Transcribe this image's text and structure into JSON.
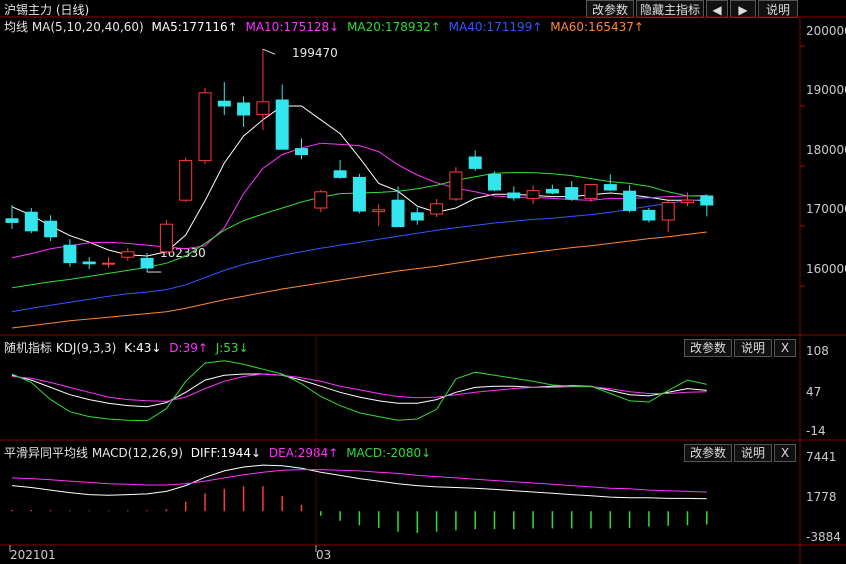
{
  "header": {
    "title": "沪锡主力 (日线)",
    "buttons": [
      "改参数",
      "隐藏主指标",
      "◀",
      "▶",
      "说明"
    ]
  },
  "main_panel": {
    "legend": [
      {
        "text": "均线 MA(5,10,20,40,60)",
        "color": "#e6e6e6"
      },
      {
        "text": "MA5:177116↑",
        "color": "#ffffff"
      },
      {
        "text": "MA10:175128↓",
        "color": "#ff33ff"
      },
      {
        "text": "MA20:178932↑",
        "color": "#33dd33"
      },
      {
        "text": "MA40:171199↑",
        "color": "#3355ff"
      },
      {
        "text": "MA60:165437↑",
        "color": "#ff8833"
      }
    ],
    "y_ticks": [
      "200000",
      "190000",
      "180000",
      "170000",
      "160000"
    ],
    "annotations": {
      "high": "199470",
      "low": "162330"
    }
  },
  "kdj_panel": {
    "legend": [
      {
        "text": "随机指标 KDJ(9,3,3)",
        "color": "#e6e6e6"
      },
      {
        "text": "K:43↓",
        "color": "#ffffff"
      },
      {
        "text": "D:39↑",
        "color": "#ff33ff"
      },
      {
        "text": "J:53↓",
        "color": "#33dd33"
      }
    ],
    "buttons": [
      "改参数",
      "说明",
      "X"
    ],
    "y_ticks": [
      "108",
      "47",
      "-14"
    ]
  },
  "macd_panel": {
    "legend": [
      {
        "text": "平滑异同平均线 MACD(12,26,9)",
        "color": "#e6e6e6"
      },
      {
        "text": "DIFF:1944↓",
        "color": "#ffffff"
      },
      {
        "text": "DEA:2984↑",
        "color": "#ff33ff"
      },
      {
        "text": "MACD:-2080↓",
        "color": "#33dd33"
      }
    ],
    "buttons": [
      "改参数",
      "说明",
      "X"
    ],
    "y_ticks": [
      "7441",
      "1778",
      "-3884"
    ]
  },
  "x_axis": {
    "labels": [
      "202101",
      "03"
    ]
  },
  "chart_data": [
    {
      "type": "candlestick",
      "title": "沪锡主力 (日线)",
      "ylim": [
        152000,
        202000
      ],
      "candles": [
        {
          "o": 171200,
          "h": 173500,
          "l": 169500,
          "c": 170600
        },
        {
          "o": 172300,
          "h": 173000,
          "l": 168800,
          "c": 169200
        },
        {
          "o": 170800,
          "h": 171800,
          "l": 167500,
          "c": 168200
        },
        {
          "o": 166800,
          "h": 167800,
          "l": 163200,
          "c": 163900
        },
        {
          "o": 164000,
          "h": 164800,
          "l": 162800,
          "c": 163700
        },
        {
          "o": 163800,
          "h": 164800,
          "l": 163000,
          "c": 163800
        },
        {
          "o": 164800,
          "h": 166300,
          "l": 164200,
          "c": 165700
        },
        {
          "o": 164600,
          "h": 165500,
          "l": 162330,
          "c": 163000
        },
        {
          "o": 165700,
          "h": 171000,
          "l": 165300,
          "c": 170300
        },
        {
          "o": 174300,
          "h": 181400,
          "l": 174000,
          "c": 180900
        },
        {
          "o": 180900,
          "h": 193000,
          "l": 180300,
          "c": 192200
        },
        {
          "o": 190800,
          "h": 194000,
          "l": 188500,
          "c": 190000
        },
        {
          "o": 190500,
          "h": 191600,
          "l": 186500,
          "c": 188500
        },
        {
          "o": 188600,
          "h": 199470,
          "l": 186000,
          "c": 190700
        },
        {
          "o": 191000,
          "h": 193600,
          "l": 183000,
          "c": 182800
        },
        {
          "o": 182900,
          "h": 184600,
          "l": 181100,
          "c": 181900
        },
        {
          "o": 173000,
          "h": 176000,
          "l": 172300,
          "c": 175700
        },
        {
          "o": 179200,
          "h": 181000,
          "l": 177900,
          "c": 178100
        },
        {
          "o": 178100,
          "h": 178700,
          "l": 172100,
          "c": 172500
        },
        {
          "o": 172400,
          "h": 173600,
          "l": 170000,
          "c": 172700
        },
        {
          "o": 174300,
          "h": 176600,
          "l": 169900,
          "c": 169900
        },
        {
          "o": 172200,
          "h": 173100,
          "l": 170200,
          "c": 171000
        },
        {
          "o": 172000,
          "h": 174500,
          "l": 171500,
          "c": 173700
        },
        {
          "o": 174500,
          "h": 179800,
          "l": 174200,
          "c": 179000
        },
        {
          "o": 181500,
          "h": 182600,
          "l": 179200,
          "c": 179600
        },
        {
          "o": 178600,
          "h": 179100,
          "l": 175800,
          "c": 176000
        },
        {
          "o": 175500,
          "h": 176600,
          "l": 174200,
          "c": 174700
        },
        {
          "o": 174600,
          "h": 176800,
          "l": 173700,
          "c": 175900
        },
        {
          "o": 176100,
          "h": 176900,
          "l": 175300,
          "c": 175500
        },
        {
          "o": 176400,
          "h": 177500,
          "l": 174200,
          "c": 174500
        },
        {
          "o": 174600,
          "h": 176900,
          "l": 174000,
          "c": 176900
        },
        {
          "o": 176900,
          "h": 178600,
          "l": 175800,
          "c": 176000
        },
        {
          "o": 175800,
          "h": 176800,
          "l": 172300,
          "c": 172600
        },
        {
          "o": 172600,
          "h": 173000,
          "l": 170600,
          "c": 171000
        },
        {
          "o": 171000,
          "h": 174200,
          "l": 169000,
          "c": 173900
        },
        {
          "o": 173900,
          "h": 175600,
          "l": 173300,
          "c": 174300
        },
        {
          "o": 175000,
          "h": 175300,
          "l": 171600,
          "c": 173500
        }
      ],
      "series": [
        {
          "name": "MA5",
          "color": "#ffffff",
          "values": [
            173200,
            171800,
            170000,
            168400,
            167300,
            166000,
            165200,
            165000,
            165700,
            168500,
            174200,
            180500,
            185000,
            187700,
            190000,
            190000,
            187700,
            185400,
            181400,
            177100,
            175800,
            173300,
            172300,
            173000,
            174600,
            175300,
            175300,
            175100,
            174900,
            174900,
            175200,
            175500,
            175200,
            174800,
            174300,
            174300,
            174300
          ]
        },
        {
          "name": "MA10",
          "color": "#ff33ff",
          "values": [
            164700,
            165400,
            166200,
            166700,
            167200,
            167300,
            167100,
            166800,
            166500,
            166200,
            166700,
            169700,
            175400,
            179600,
            181900,
            183000,
            183800,
            183600,
            183400,
            182400,
            180200,
            178500,
            177200,
            176300,
            175700,
            175000,
            174800,
            174800,
            174600,
            174400,
            174300,
            174600,
            174600,
            174700,
            174900,
            175000,
            175100
          ]
        },
        {
          "name": "MA20",
          "color": "#33dd33",
          "values": [
            159700,
            160200,
            160700,
            161100,
            161600,
            162100,
            162600,
            163100,
            163800,
            165000,
            167100,
            169300,
            170900,
            172000,
            173000,
            174000,
            174800,
            175400,
            175500,
            175600,
            175800,
            176200,
            176800,
            177600,
            178200,
            178800,
            178900,
            178900,
            178700,
            178400,
            177900,
            177400,
            177100,
            176600,
            175700,
            175000,
            175000
          ]
        },
        {
          "name": "MA40",
          "color": "#3355ff",
          "values": [
            155700,
            156300,
            156800,
            157300,
            157800,
            158300,
            158700,
            159000,
            159400,
            160200,
            161400,
            162600,
            163600,
            164400,
            165100,
            165700,
            166300,
            166800,
            167300,
            167800,
            168300,
            168800,
            169300,
            169700,
            170100,
            170500,
            170800,
            171100,
            171300,
            171600,
            171900,
            172300,
            172800,
            173300,
            173800,
            174200,
            174500
          ]
        },
        {
          "name": "MA60",
          "color": "#ff8833",
          "values": [
            153000,
            153400,
            153800,
            154200,
            154500,
            154800,
            155100,
            155400,
            155700,
            156300,
            157000,
            157700,
            158300,
            158900,
            159500,
            160000,
            160500,
            161000,
            161500,
            162000,
            162500,
            162900,
            163300,
            163800,
            164300,
            164800,
            165200,
            165600,
            166000,
            166400,
            166700,
            167100,
            167500,
            167900,
            168200,
            168600,
            169000
          ]
        }
      ]
    },
    {
      "type": "line",
      "title": "随机指标 KDJ(9,3,3)",
      "ylim": [
        -20,
        115
      ],
      "series": [
        {
          "name": "K",
          "color": "#ffffff",
          "values": [
            80,
            72,
            60,
            48,
            40,
            34,
            30,
            28,
            35,
            52,
            72,
            80,
            82,
            82,
            80,
            72,
            62,
            52,
            44,
            38,
            34,
            34,
            40,
            52,
            60,
            62,
            62,
            60,
            62,
            63,
            62,
            55,
            48,
            46,
            52,
            58,
            55
          ]
        },
        {
          "name": "D",
          "color": "#ff33ff",
          "values": [
            78,
            75,
            68,
            60,
            52,
            44,
            40,
            38,
            37,
            44,
            58,
            70,
            78,
            82,
            80,
            76,
            70,
            62,
            56,
            50,
            45,
            43,
            44,
            48,
            52,
            55,
            58,
            60,
            60,
            61,
            61,
            58,
            53,
            50,
            50,
            52,
            53
          ]
        },
        {
          "name": "J",
          "color": "#33dd33",
          "values": [
            82,
            68,
            40,
            20,
            12,
            8,
            6,
            5,
            25,
            70,
            100,
            104,
            98,
            90,
            82,
            66,
            45,
            30,
            18,
            12,
            6,
            8,
            24,
            74,
            85,
            80,
            75,
            70,
            64,
            62,
            62,
            50,
            38,
            36,
            55,
            72,
            65
          ]
        }
      ]
    },
    {
      "type": "bar",
      "title": "平滑异同平均线 MACD(12,26,9)",
      "ylim": [
        -4500,
        8000
      ],
      "series": [
        {
          "name": "DIFF",
          "color": "#ffffff",
          "values": [
            4000,
            3700,
            3300,
            2900,
            2600,
            2500,
            2600,
            2700,
            3100,
            4000,
            5300,
            6300,
            6900,
            7200,
            7100,
            6700,
            6100,
            5600,
            5100,
            4700,
            4300,
            4000,
            3800,
            3700,
            3600,
            3400,
            3200,
            3000,
            2800,
            2600,
            2400,
            2200,
            2100,
            2100,
            2000,
            2000,
            1944
          ]
        },
        {
          "name": "DEA",
          "color": "#ff33ff",
          "values": [
            5200,
            5100,
            4900,
            4700,
            4500,
            4300,
            4200,
            4100,
            4100,
            4300,
            4700,
            5200,
            5700,
            6100,
            6400,
            6500,
            6500,
            6400,
            6300,
            6100,
            5900,
            5600,
            5400,
            5200,
            5000,
            4800,
            4600,
            4400,
            4200,
            4000,
            3800,
            3600,
            3500,
            3300,
            3200,
            3100,
            2984
          ]
        },
        {
          "name": "MACD",
          "color": "#33dd33",
          "values": [
            200,
            180,
            150,
            110,
            100,
            90,
            120,
            150,
            300,
            1500,
            2800,
            3500,
            3900,
            3900,
            2400,
            1000,
            -700,
            -1500,
            -2200,
            -2600,
            -3200,
            -3400,
            -3200,
            -3000,
            -2800,
            -2800,
            -2800,
            -2700,
            -2700,
            -2700,
            -2700,
            -2700,
            -2600,
            -2400,
            -2300,
            -2200,
            -2080
          ]
        }
      ]
    }
  ]
}
